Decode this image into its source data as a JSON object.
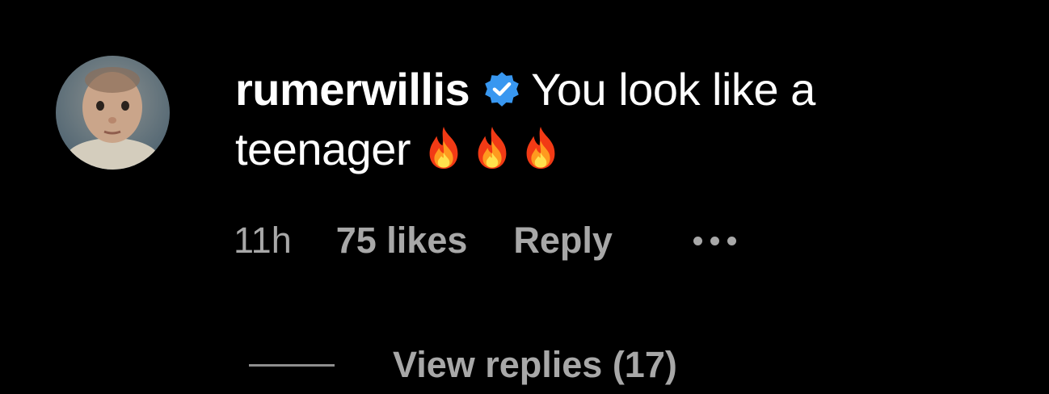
{
  "comment": {
    "username": "rumerwillis",
    "verified_icon": "verified-badge-icon",
    "text": "You look like a teenager",
    "emojis": [
      "fire-icon",
      "fire-icon",
      "fire-icon"
    ],
    "time": "11h",
    "likes": "75 likes",
    "reply_label": "Reply",
    "more_icon": "more-options-icon",
    "view_replies_label": "View replies (17)"
  },
  "colors": {
    "background": "#000000",
    "text": "#ffffff",
    "muted_text": "#a8a8a8",
    "verified_blue": "#3897f0"
  }
}
